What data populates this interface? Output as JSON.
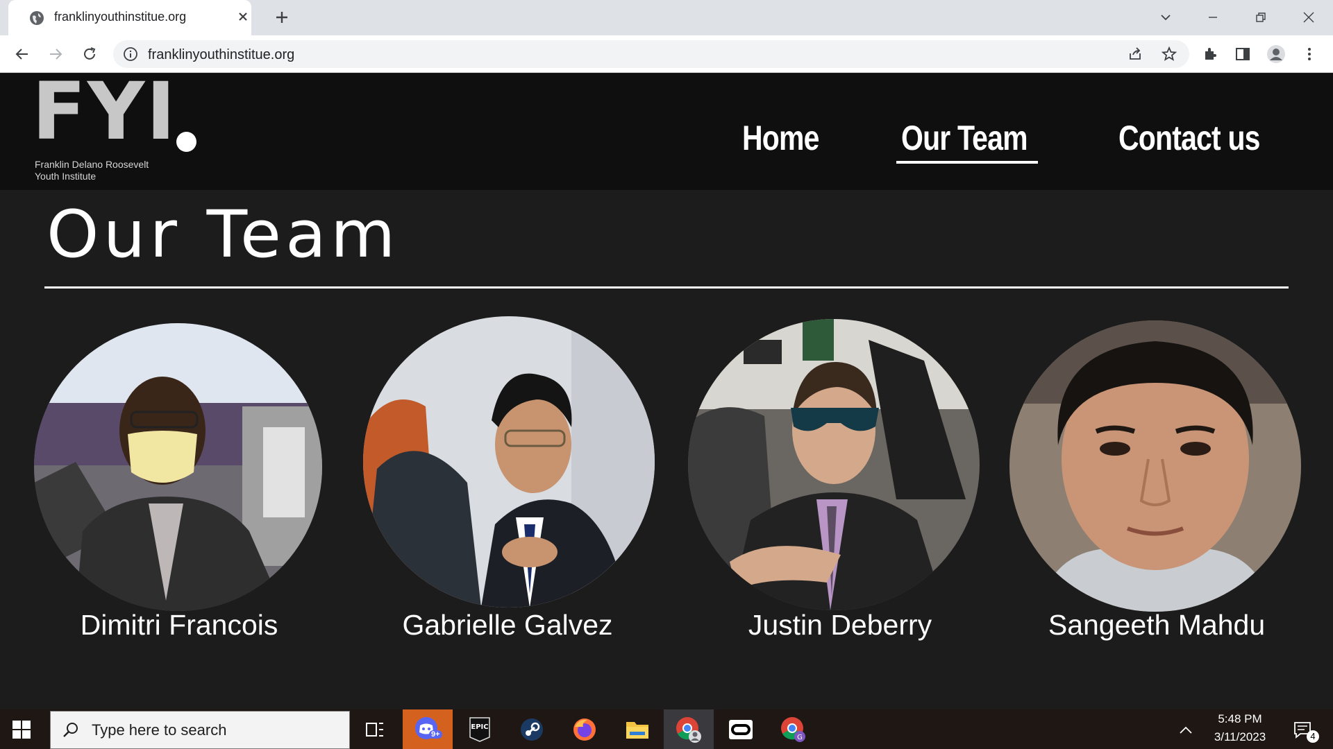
{
  "browser": {
    "tab_title": "franklinyouthinstitue.org",
    "url": "franklinyouthinstitue.org"
  },
  "site": {
    "logo": {
      "mark": "FYI",
      "subtitle_line1": "Franklin Delano Roosevelt",
      "subtitle_line2": "Youth Institute"
    },
    "nav": [
      {
        "label": "Home",
        "active": false
      },
      {
        "label": "Our Team",
        "active": true
      },
      {
        "label": "Contact us",
        "active": false
      }
    ],
    "page_title": "Our Team",
    "members": [
      {
        "name": "Dimitri Francois"
      },
      {
        "name": "Gabrielle Galvez"
      },
      {
        "name": "Justin Deberry"
      },
      {
        "name": "Sangeeth Mahdu"
      }
    ]
  },
  "taskbar": {
    "search_placeholder": "Type here to search",
    "discord_badge": "9+",
    "time": "5:48 PM",
    "date": "3/11/2023",
    "notification_count": "4"
  },
  "colors": {
    "site_bg": "#1c1c1c",
    "header_bg": "#0f0f0f",
    "text": "#ffffff"
  }
}
